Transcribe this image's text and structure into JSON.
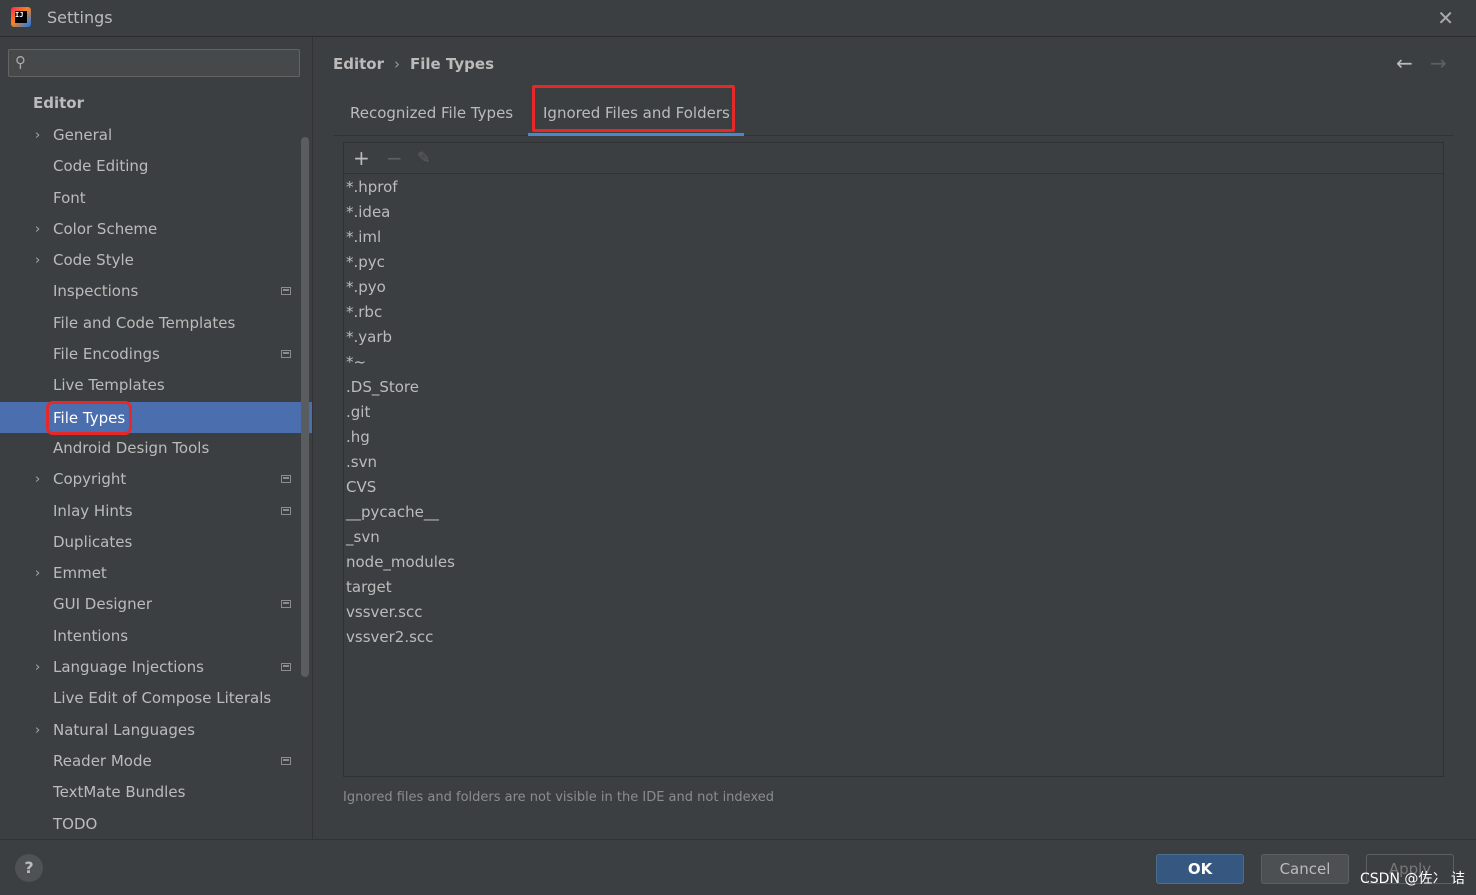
{
  "window": {
    "title": "Settings",
    "close_icon": "✕"
  },
  "sidebar": {
    "search_placeholder": "",
    "header": "Editor",
    "items": [
      {
        "label": "General",
        "expandable": true,
        "project": false
      },
      {
        "label": "Code Editing",
        "expandable": false,
        "project": false
      },
      {
        "label": "Font",
        "expandable": false,
        "project": false
      },
      {
        "label": "Color Scheme",
        "expandable": true,
        "project": false
      },
      {
        "label": "Code Style",
        "expandable": true,
        "project": false
      },
      {
        "label": "Inspections",
        "expandable": false,
        "project": true
      },
      {
        "label": "File and Code Templates",
        "expandable": false,
        "project": false
      },
      {
        "label": "File Encodings",
        "expandable": false,
        "project": true
      },
      {
        "label": "Live Templates",
        "expandable": false,
        "project": false
      },
      {
        "label": "File Types",
        "expandable": false,
        "project": false,
        "selected": true
      },
      {
        "label": "Android Design Tools",
        "expandable": false,
        "project": false
      },
      {
        "label": "Copyright",
        "expandable": true,
        "project": true
      },
      {
        "label": "Inlay Hints",
        "expandable": false,
        "project": true
      },
      {
        "label": "Duplicates",
        "expandable": false,
        "project": false
      },
      {
        "label": "Emmet",
        "expandable": true,
        "project": false
      },
      {
        "label": "GUI Designer",
        "expandable": false,
        "project": true
      },
      {
        "label": "Intentions",
        "expandable": false,
        "project": false
      },
      {
        "label": "Language Injections",
        "expandable": true,
        "project": true
      },
      {
        "label": "Live Edit of Compose Literals",
        "expandable": false,
        "project": false
      },
      {
        "label": "Natural Languages",
        "expandable": true,
        "project": false
      },
      {
        "label": "Reader Mode",
        "expandable": false,
        "project": true
      },
      {
        "label": "TextMate Bundles",
        "expandable": false,
        "project": false
      },
      {
        "label": "TODO",
        "expandable": false,
        "project": false
      }
    ]
  },
  "breadcrumb": {
    "parent": "Editor",
    "separator": "›",
    "current": "File Types"
  },
  "nav": {
    "back": "←",
    "forward": "→"
  },
  "tabs": {
    "recognized": "Recognized File Types",
    "ignored": "Ignored Files and Folders"
  },
  "toolbar": {
    "add": "+",
    "remove": "−",
    "edit": "✎"
  },
  "ignored_patterns": [
    "*.hprof",
    "*.idea",
    "*.iml",
    "*.pyc",
    "*.pyo",
    "*.rbc",
    "*.yarb",
    "*~",
    ".DS_Store",
    ".git",
    ".hg",
    ".svn",
    "CVS",
    "__pycache__",
    "_svn",
    "node_modules",
    "target",
    "vssver.scc",
    "vssver2.scc"
  ],
  "hint": "Ignored files and folders are not visible in the IDE and not indexed",
  "footer": {
    "help": "?",
    "ok": "OK",
    "cancel": "Cancel",
    "apply": "Apply",
    "watermark": "CSDN @佐冫 诘"
  }
}
